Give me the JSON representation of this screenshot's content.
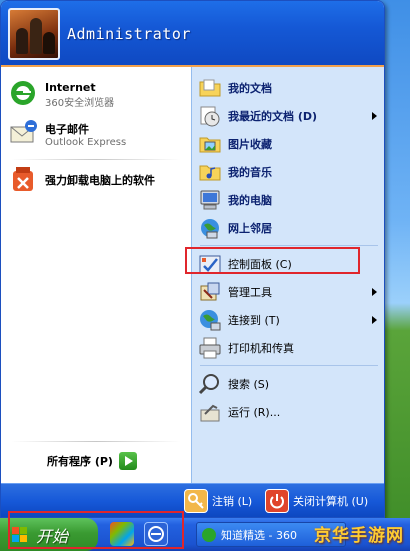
{
  "user": {
    "name": "Administrator"
  },
  "left": {
    "pinned": [
      {
        "title": "Internet",
        "subtitle": "360安全浏览器",
        "icon": "ie-browser-icon"
      },
      {
        "title": "电子邮件",
        "subtitle": "Outlook Express",
        "icon": "email-icon"
      }
    ],
    "recent": [
      {
        "title": "强力卸载电脑上的软件",
        "icon": "uninstall-icon"
      }
    ],
    "all_programs": "所有程序 (P)"
  },
  "right": {
    "items": [
      {
        "label": "我的文档",
        "icon": "my-documents-icon",
        "submenu": false
      },
      {
        "label": "我最近的文档 (D)",
        "icon": "recent-documents-icon",
        "submenu": true
      },
      {
        "label": "图片收藏",
        "icon": "my-pictures-icon",
        "submenu": false
      },
      {
        "label": "我的音乐",
        "icon": "my-music-icon",
        "submenu": false
      },
      {
        "label": "我的电脑",
        "icon": "my-computer-icon",
        "submenu": false
      },
      {
        "label": "网上邻居",
        "icon": "network-places-icon",
        "submenu": false
      },
      {
        "label": "控制面板 (C)",
        "icon": "control-panel-icon",
        "submenu": false
      },
      {
        "label": "管理工具",
        "icon": "admin-tools-icon",
        "submenu": true
      },
      {
        "label": "连接到 (T)",
        "icon": "connect-to-icon",
        "submenu": true
      },
      {
        "label": "打印机和传真",
        "icon": "printers-icon",
        "submenu": false
      },
      {
        "label": "搜索 (S)",
        "icon": "search-icon",
        "submenu": false
      },
      {
        "label": "运行 (R)...",
        "icon": "run-icon",
        "submenu": false
      }
    ]
  },
  "footer": {
    "logoff": "注销 (L)",
    "shutdown": "关闭计算机 (U)"
  },
  "taskbar": {
    "start_label": "开始",
    "task_label": "知道精选 - 360",
    "watermark": "京华手游网"
  },
  "colors": {
    "menu_blue": "#1559d6",
    "right_pane": "#d3e5fa",
    "start_green": "#3a9b32",
    "highlight_red": "#e0262c"
  }
}
